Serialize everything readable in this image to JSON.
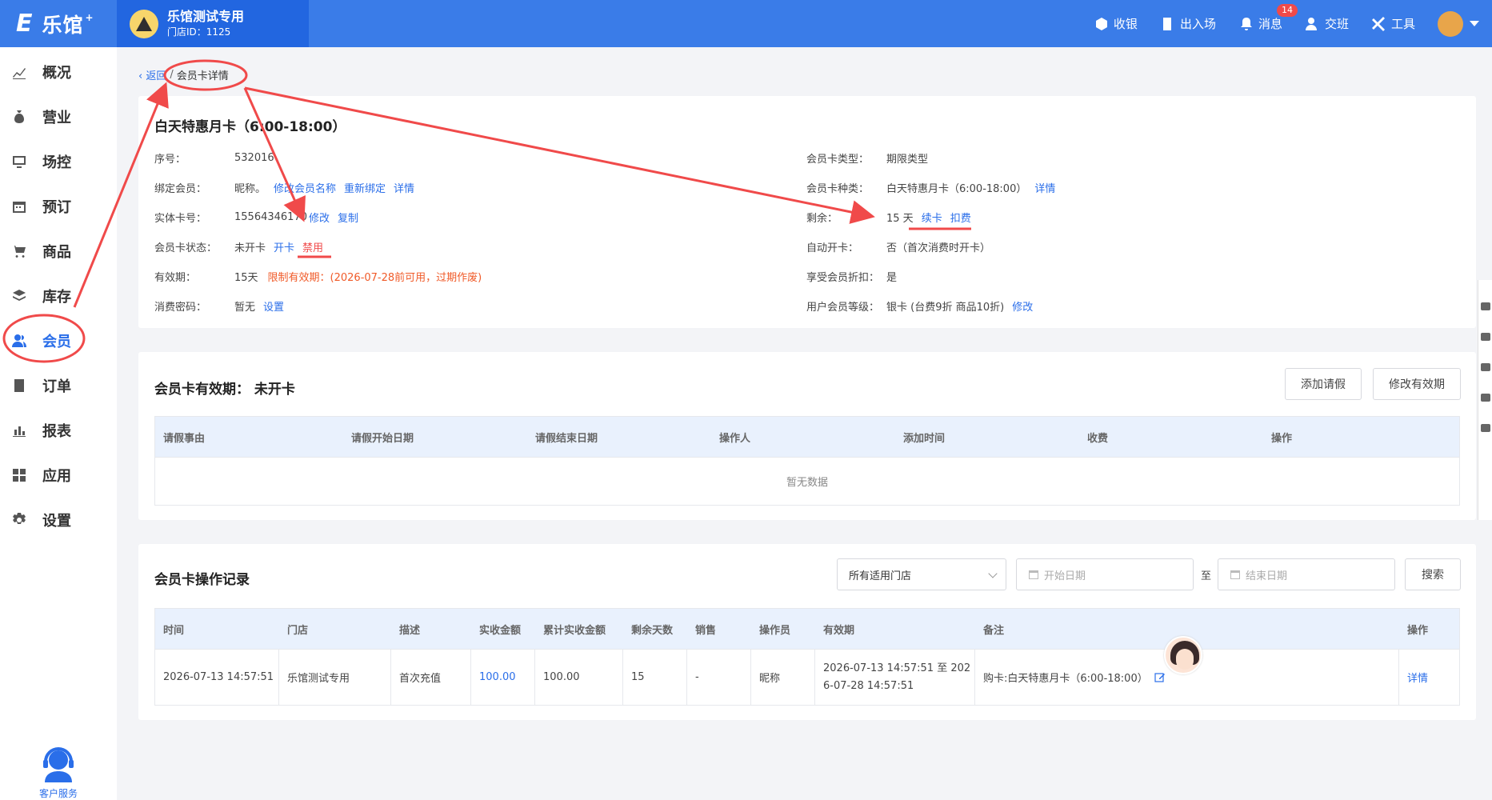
{
  "brand": {
    "logo_mark": "E",
    "logo_text": "乐馆",
    "logo_plus": "+"
  },
  "store": {
    "name": "乐馆测试专用",
    "id_label": "门店ID：1125"
  },
  "top_actions": {
    "cashier": "收银",
    "entry": "出入场",
    "messages": "消息",
    "message_count": "14",
    "handover": "交班",
    "tools": "工具"
  },
  "sidebar": {
    "items": [
      {
        "label": "概况",
        "icon": "trend-icon"
      },
      {
        "label": "营业",
        "icon": "money-bag-icon"
      },
      {
        "label": "场控",
        "icon": "monitor-icon"
      },
      {
        "label": "预订",
        "icon": "calendar-icon"
      },
      {
        "label": "商品",
        "icon": "cart-icon"
      },
      {
        "label": "库存",
        "icon": "layers-icon"
      },
      {
        "label": "会员",
        "icon": "members-icon"
      },
      {
        "label": "订单",
        "icon": "order-icon"
      },
      {
        "label": "报表",
        "icon": "bar-chart-icon"
      },
      {
        "label": "应用",
        "icon": "apps-icon"
      },
      {
        "label": "设置",
        "icon": "gear-icon"
      }
    ],
    "active_index": 6,
    "service_label": "客户服务"
  },
  "breadcrumb": {
    "back": "返回",
    "sep": "/",
    "current": "会员卡详情"
  },
  "card": {
    "title": "白天特惠月卡（6:00-18:00）",
    "left": {
      "serial_label": "序号：",
      "serial_value": "532016",
      "bind_label": "绑定会员：",
      "bind_value": "昵称。",
      "bind_edit": "修改会员名称",
      "bind_rebind": "重新绑定",
      "bind_detail": "详情",
      "physical_label": "实体卡号：",
      "physical_value": "15564346170",
      "physical_edit": "修改",
      "physical_copy": "复制",
      "status_label": "会员卡状态：",
      "status_value": "未开卡",
      "status_open": "开卡",
      "status_disable": "禁用",
      "validity_label": "有效期：",
      "validity_value": "15天",
      "validity_note": "限制有效期：(2026-07-28前可用，过期作废)",
      "pwd_label": "消费密码：",
      "pwd_value": "暂无",
      "pwd_set": "设置"
    },
    "right": {
      "type_label": "会员卡类型：",
      "type_value": "期限类型",
      "kind_label": "会员卡种类：",
      "kind_value": "白天特惠月卡（6:00-18:00）",
      "kind_detail": "详情",
      "remain_label": "剩余：",
      "remain_value": "15 天",
      "remain_renew": "续卡",
      "remain_deduct": "扣费",
      "auto_label": "自动开卡：",
      "auto_value": "否（首次消费时开卡）",
      "discount_label": "享受会员折扣：",
      "discount_value": "是",
      "level_label": "用户会员等级：",
      "level_value": "银卡 (台费9折 商品10折)",
      "level_edit": "修改"
    }
  },
  "leave": {
    "title": "会员卡有效期：  未开卡",
    "add_button": "添加请假",
    "edit_button": "修改有效期",
    "columns": [
      "请假事由",
      "请假开始日期",
      "请假结束日期",
      "操作人",
      "添加时间",
      "收费",
      "操作"
    ],
    "empty": "暂无数据"
  },
  "records": {
    "title": "会员卡操作记录",
    "store_select": "所有适用门店",
    "start_placeholder": "开始日期",
    "to_label": "至",
    "end_placeholder": "结束日期",
    "search_button": "搜索",
    "columns": [
      "时间",
      "门店",
      "描述",
      "实收金额",
      "累计实收金额",
      "剩余天数",
      "销售",
      "操作员",
      "有效期",
      "备注",
      "操作"
    ],
    "rows": [
      {
        "time": "2026-07-13 14:57:51",
        "store": "乐馆测试专用",
        "desc": "首次充值",
        "paid": "100.00",
        "total": "100.00",
        "days": "15",
        "sales": "-",
        "operator": "昵称",
        "validity_line1": "2026-07-13 14:57:51 至 202",
        "validity_line2": "6-07-28 14:57:51",
        "remark": "购卡:白天特惠月卡（6:00-18:00）",
        "action": "详情"
      }
    ]
  },
  "colors": {
    "primary": "#3a7ce8",
    "store_bg": "#2266e0",
    "link": "#2a6ee9",
    "warn": "#f05a28",
    "annotation": "#f04a4a"
  }
}
